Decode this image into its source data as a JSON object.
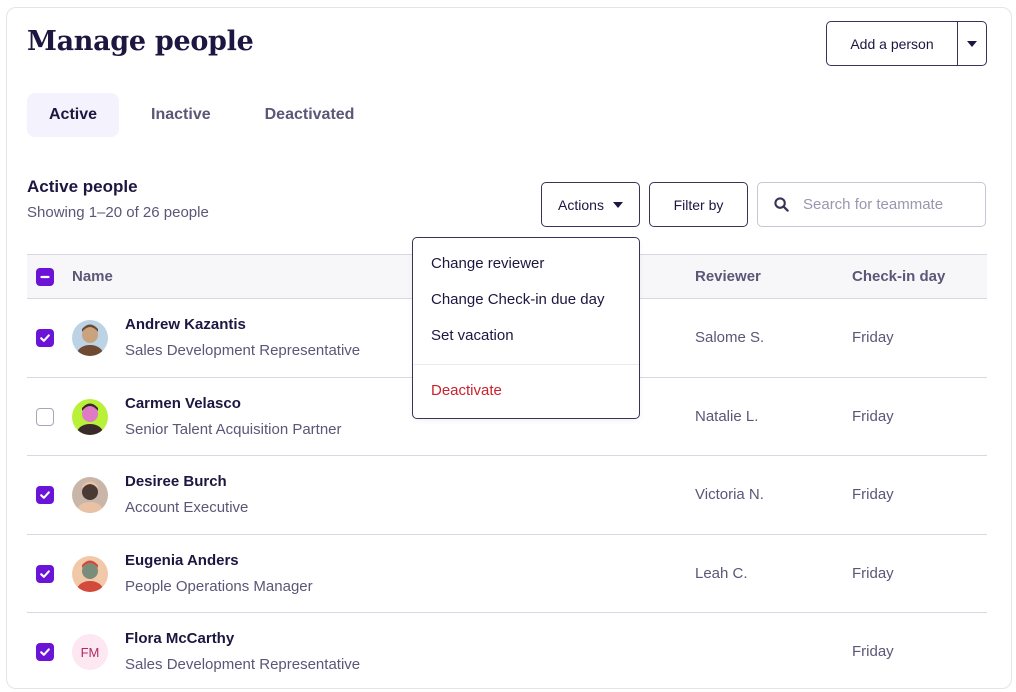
{
  "header": {
    "title": "Manage people",
    "add_button_label": "Add a person"
  },
  "tabs": [
    {
      "label": "Active",
      "active": true
    },
    {
      "label": "Inactive",
      "active": false
    },
    {
      "label": "Deactivated",
      "active": false
    }
  ],
  "section": {
    "title": "Active people",
    "subtitle": "Showing 1–20 of 26 people"
  },
  "toolbar": {
    "actions_label": "Actions",
    "filter_label": "Filter by",
    "search_placeholder": "Search for teammate",
    "search_value": ""
  },
  "actions_menu": {
    "items": [
      "Change reviewer",
      "Change Check-in due day",
      "Set vacation"
    ],
    "danger_item": "Deactivate",
    "danger_color": "#c8232c"
  },
  "table": {
    "columns": {
      "name": "Name",
      "reviewer": "Reviewer",
      "checkin": "Check-in day"
    },
    "select_all_state": "indeterminate",
    "rows": [
      {
        "name": "Andrew Kazantis",
        "role": "Sales Development Representative",
        "reviewer": "Salome S.",
        "checkin_day": "Friday",
        "checked": true,
        "avatar": "photo",
        "initials": ""
      },
      {
        "name": "Carmen Velasco",
        "role": "Senior Talent Acquisition Partner",
        "reviewer": "Natalie L.",
        "checkin_day": "Friday",
        "checked": false,
        "avatar": "photo",
        "initials": ""
      },
      {
        "name": "Desiree Burch",
        "role": "Account Executive",
        "reviewer": "Victoria N.",
        "checkin_day": "Friday",
        "checked": true,
        "avatar": "photo",
        "initials": ""
      },
      {
        "name": "Eugenia Anders",
        "role": "People Operations Manager",
        "reviewer": "Leah C.",
        "checkin_day": "Friday",
        "checked": true,
        "avatar": "photo",
        "initials": ""
      },
      {
        "name": "Flora McCarthy",
        "role": "Sales Development Representative",
        "reviewer": "",
        "checkin_day": "Friday",
        "checked": true,
        "avatar": "initials",
        "initials": "FM"
      }
    ]
  },
  "colors": {
    "accent": "#6b14d8",
    "text_primary": "#1c1640",
    "text_secondary": "#5c5677",
    "active_tab_bg": "#f4f2fd",
    "initials_bg": "#fde8f1",
    "initials_fg": "#b02a66"
  }
}
